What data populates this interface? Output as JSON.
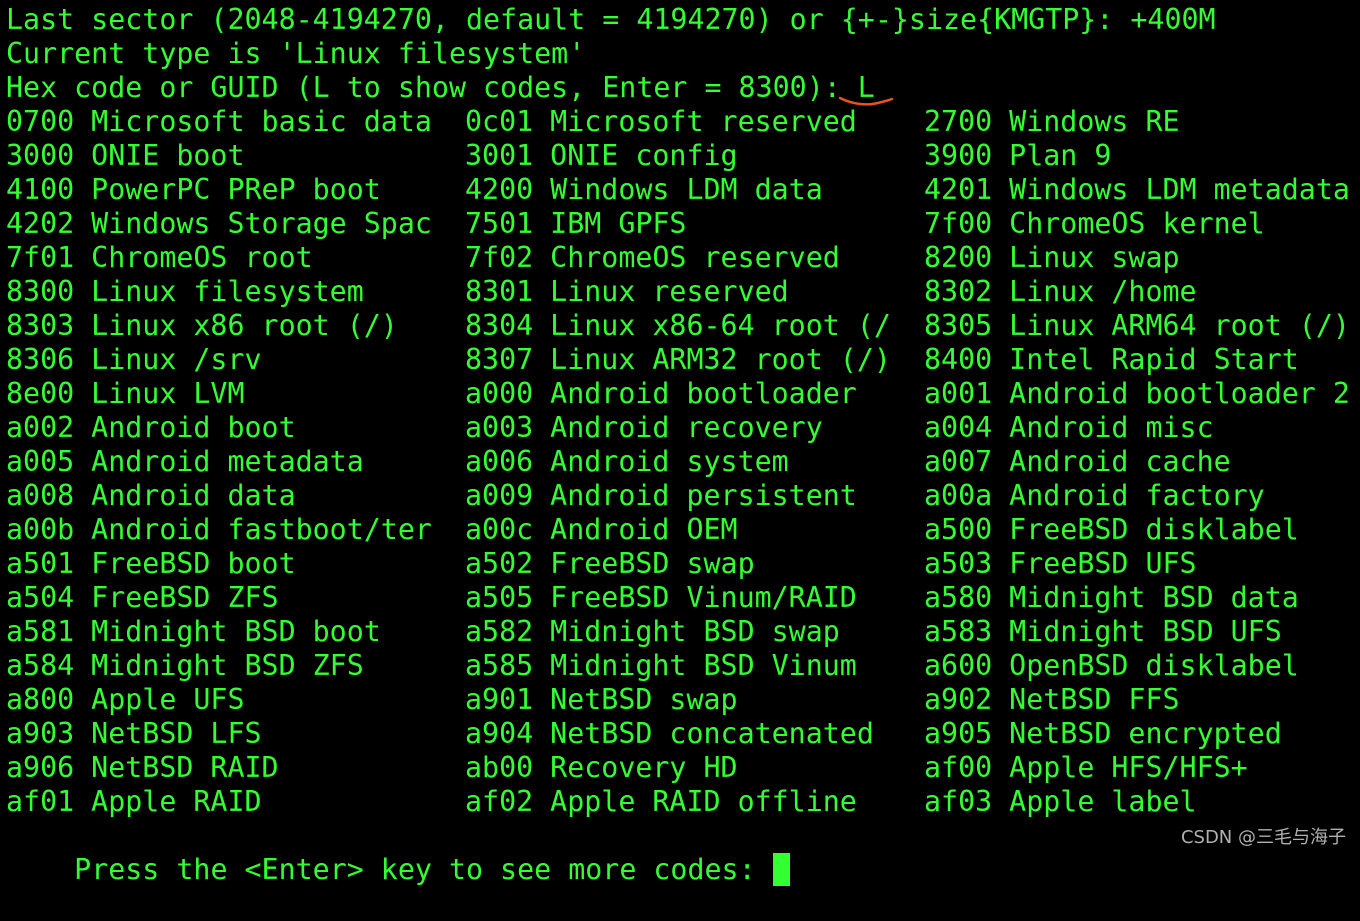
{
  "terminal": {
    "colors": {
      "background": "#000000",
      "text": "#33ff33",
      "annotation": "#e8541a",
      "watermark": "#cfcfcf"
    },
    "prompt_lines": [
      "Last sector (2048-4194270, default = 4194270) or {+-}size{KMGTP}: +400M",
      "Current type is 'Linux filesystem'",
      "Hex code or GUID (L to show codes, Enter = 8300): L"
    ],
    "code_rows": [
      [
        "0700 Microsoft basic data",
        "0c01 Microsoft reserved",
        "2700 Windows RE"
      ],
      [
        "3000 ONIE boot",
        "3001 ONIE config",
        "3900 Plan 9"
      ],
      [
        "4100 PowerPC PReP boot",
        "4200 Windows LDM data",
        "4201 Windows LDM metadata"
      ],
      [
        "4202 Windows Storage Spac",
        "7501 IBM GPFS",
        "7f00 ChromeOS kernel"
      ],
      [
        "7f01 ChromeOS root",
        "7f02 ChromeOS reserved",
        "8200 Linux swap"
      ],
      [
        "8300 Linux filesystem",
        "8301 Linux reserved",
        "8302 Linux /home"
      ],
      [
        "8303 Linux x86 root (/)",
        "8304 Linux x86-64 root (/",
        "8305 Linux ARM64 root (/)"
      ],
      [
        "8306 Linux /srv",
        "8307 Linux ARM32 root (/)",
        "8400 Intel Rapid Start"
      ],
      [
        "8e00 Linux LVM",
        "a000 Android bootloader",
        "a001 Android bootloader 2"
      ],
      [
        "a002 Android boot",
        "a003 Android recovery",
        "a004 Android misc"
      ],
      [
        "a005 Android metadata",
        "a006 Android system",
        "a007 Android cache"
      ],
      [
        "a008 Android data",
        "a009 Android persistent",
        "a00a Android factory"
      ],
      [
        "a00b Android fastboot/ter",
        "a00c Android OEM",
        "a500 FreeBSD disklabel"
      ],
      [
        "a501 FreeBSD boot",
        "a502 FreeBSD swap",
        "a503 FreeBSD UFS"
      ],
      [
        "a504 FreeBSD ZFS",
        "a505 FreeBSD Vinum/RAID",
        "a580 Midnight BSD data"
      ],
      [
        "a581 Midnight BSD boot",
        "a582 Midnight BSD swap",
        "a583 Midnight BSD UFS"
      ],
      [
        "a584 Midnight BSD ZFS",
        "a585 Midnight BSD Vinum",
        "a600 OpenBSD disklabel"
      ],
      [
        "a800 Apple UFS",
        "a901 NetBSD swap",
        "a902 NetBSD FFS"
      ],
      [
        "a903 NetBSD LFS",
        "a904 NetBSD concatenated",
        "a905 NetBSD encrypted"
      ],
      [
        "a906 NetBSD RAID",
        "ab00 Recovery HD",
        "af00 Apple HFS/HFS+"
      ],
      [
        "af01 Apple RAID",
        "af02 Apple RAID offline",
        "af03 Apple label"
      ]
    ],
    "more_prompt": "Press the <Enter> key to see more codes: "
  },
  "watermark": "CSDN @三毛与海子"
}
